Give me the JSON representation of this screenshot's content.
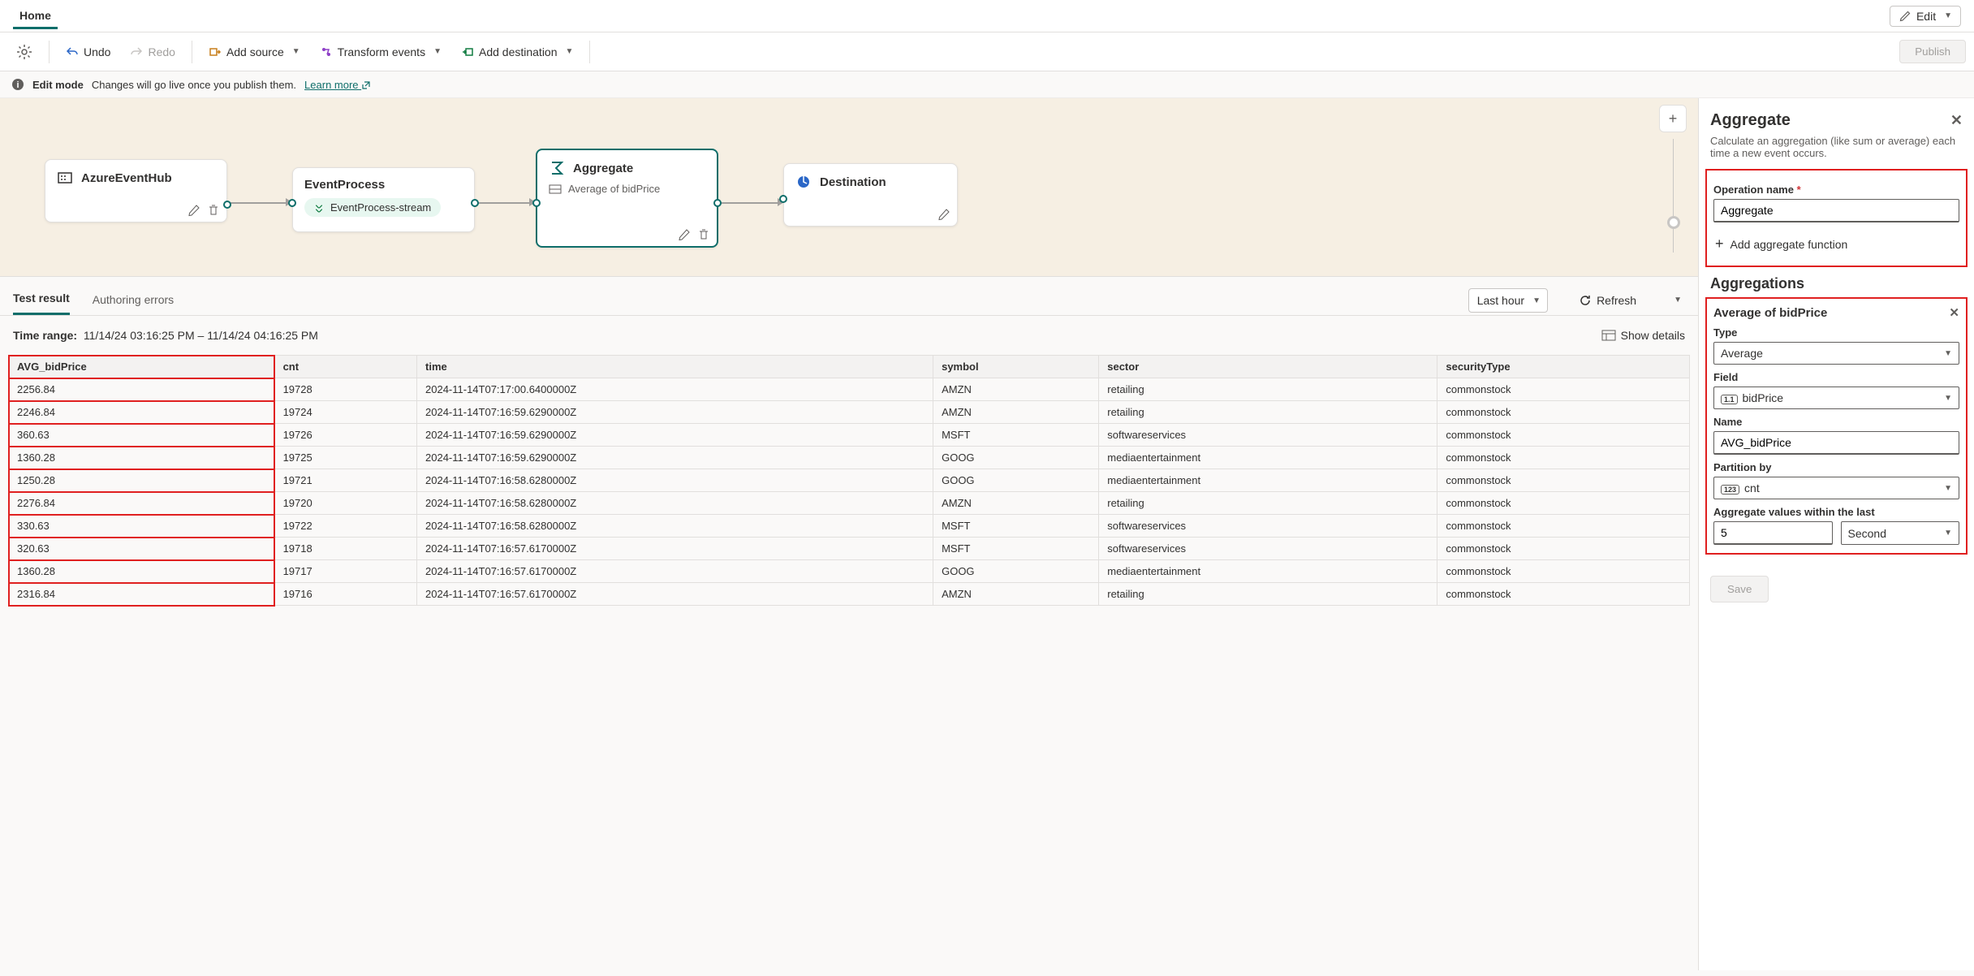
{
  "tabs": {
    "home": "Home"
  },
  "editBtn": "Edit",
  "toolbar": {
    "undo": "Undo",
    "redo": "Redo",
    "addSource": "Add source",
    "transform": "Transform events",
    "addDest": "Add destination",
    "publish": "Publish"
  },
  "notice": {
    "title": "Edit mode",
    "desc": "Changes will go live once you publish them.",
    "learn": "Learn more"
  },
  "canvas": {
    "node1": {
      "title": "AzureEventHub"
    },
    "node2": {
      "title": "EventProcess",
      "chip": "EventProcess-stream"
    },
    "node3": {
      "title": "Aggregate",
      "sub": "Average of bidPrice"
    },
    "node4": {
      "title": "Destination"
    }
  },
  "bottomTabs": {
    "test": "Test result",
    "authoring": "Authoring errors",
    "timeSel": "Last hour",
    "refresh": "Refresh"
  },
  "timeRange": {
    "label": "Time range:",
    "value": "11/14/24 03:16:25 PM  –  11/14/24 04:16:25 PM",
    "details": "Show details"
  },
  "table": {
    "headers": [
      "AVG_bidPrice",
      "cnt",
      "time",
      "symbol",
      "sector",
      "securityType"
    ],
    "rows": [
      [
        "2256.84",
        "19728",
        "2024-11-14T07:17:00.6400000Z",
        "AMZN",
        "retailing",
        "commonstock"
      ],
      [
        "2246.84",
        "19724",
        "2024-11-14T07:16:59.6290000Z",
        "AMZN",
        "retailing",
        "commonstock"
      ],
      [
        "360.63",
        "19726",
        "2024-11-14T07:16:59.6290000Z",
        "MSFT",
        "softwareservices",
        "commonstock"
      ],
      [
        "1360.28",
        "19725",
        "2024-11-14T07:16:59.6290000Z",
        "GOOG",
        "mediaentertainment",
        "commonstock"
      ],
      [
        "1250.28",
        "19721",
        "2024-11-14T07:16:58.6280000Z",
        "GOOG",
        "mediaentertainment",
        "commonstock"
      ],
      [
        "2276.84",
        "19720",
        "2024-11-14T07:16:58.6280000Z",
        "AMZN",
        "retailing",
        "commonstock"
      ],
      [
        "330.63",
        "19722",
        "2024-11-14T07:16:58.6280000Z",
        "MSFT",
        "softwareservices",
        "commonstock"
      ],
      [
        "320.63",
        "19718",
        "2024-11-14T07:16:57.6170000Z",
        "MSFT",
        "softwareservices",
        "commonstock"
      ],
      [
        "1360.28",
        "19717",
        "2024-11-14T07:16:57.6170000Z",
        "GOOG",
        "mediaentertainment",
        "commonstock"
      ],
      [
        "2316.84",
        "19716",
        "2024-11-14T07:16:57.6170000Z",
        "AMZN",
        "retailing",
        "commonstock"
      ]
    ]
  },
  "panel": {
    "title": "Aggregate",
    "desc": "Calculate an aggregation (like sum or average) each time a new event occurs.",
    "opNameLabel": "Operation name",
    "opName": "Aggregate",
    "addFn": "Add aggregate function",
    "aggregations": "Aggregations",
    "aggTitle": "Average of bidPrice",
    "typeLabel": "Type",
    "type": "Average",
    "fieldLabel": "Field",
    "fieldBadge": "1.1",
    "field": "bidPrice",
    "nameLabel": "Name",
    "name": "AVG_bidPrice",
    "partitionLabel": "Partition by",
    "partitionBadge": "123",
    "partition": "cnt",
    "windowLabel": "Aggregate values within the last",
    "windowVal": "5",
    "windowUnit": "Second",
    "save": "Save"
  }
}
